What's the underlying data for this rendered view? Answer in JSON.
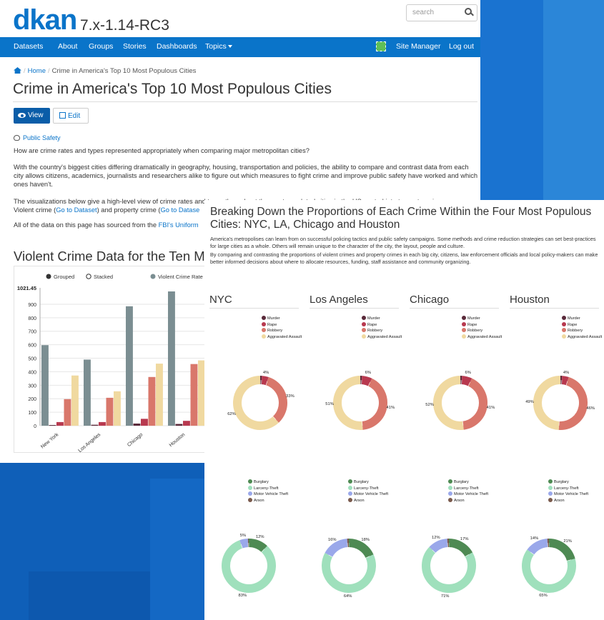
{
  "site": {
    "logo": "dkan",
    "version": "7.x-1.14-RC3",
    "search_placeholder": "search",
    "nav": [
      "Datasets",
      "About",
      "Groups",
      "Stories",
      "Dashboards",
      "Topics"
    ],
    "nav_right": [
      "Site Manager",
      "Log out"
    ]
  },
  "breadcrumb": {
    "home": "Home",
    "current": "Crime in America's Top 10 Most Populous Cities"
  },
  "page": {
    "title": "Crime in America's Top 10 Most Populous Cities",
    "view_label": "View",
    "edit_label": "Edit",
    "topic": "Public Safety",
    "p1": "How are crime rates and types represented appropriately when comparing major metropolitan cities?",
    "p2": "With the country's biggest cities differing dramatically in geography, housing, transportation and policies, the ability to compare and contrast data from each city allows citizens, academics, journalists and researchers alike to figure out which measures to fight crime and improve public safety have worked and which ones haven't.",
    "p3a": "The visualizations below give a high-level view of crime rates and types throughout the most populated cities in the US, sorted into two categories:",
    "p3b_pre": "Violent crime (",
    "p3b_link": "Go to Dataset",
    "p3b_mid": ") and property crime (",
    "p3b_link2": "Go to Datase",
    "p4_pre": "All of the data on this page has sourced from the ",
    "p4_link": "FBI's Uniform",
    "h2": "Violent Crime Data for the Ten Most"
  },
  "colors": {
    "brand": "#0a74c9",
    "murder": "#5a2a3a",
    "rape": "#b8394f",
    "robbery": "#d9776b",
    "assault": "#f0d9a0",
    "rate": "#7b8e92",
    "burglary": "#4e8a53",
    "larceny": "#9fe0bc",
    "vehicle": "#9aa8ea",
    "arson": "#7a5a4c"
  },
  "chart_data": [
    {
      "type": "bar",
      "controls": [
        "Grouped",
        "Stacked"
      ],
      "legend": [
        "Violent Crime Rate P..."
      ],
      "ymax_label": "1021.45",
      "yticks": [
        0,
        100,
        200,
        300,
        400,
        500,
        600,
        700,
        800,
        900
      ],
      "ylim": [
        0,
        1021.45
      ],
      "categories": [
        "New York",
        "Los Angeles",
        "Chicago",
        "Houston"
      ],
      "series": [
        {
          "name": "Violent Crime Rate P...",
          "values": [
            597,
            490,
            885,
            995
          ]
        },
        {
          "values": [
            5,
            7,
            16,
            13
          ]
        },
        {
          "values": [
            27,
            27,
            51,
            36
          ]
        },
        {
          "values": [
            197,
            207,
            361,
            457
          ]
        },
        {
          "values": [
            372,
            255,
            460,
            484
          ]
        }
      ]
    },
    {
      "type": "pie",
      "title": "Breaking Down the Proportions of Each Crime Within the Four Most Populous Cities: NYC, LA, Chicago and Houston",
      "p1": "America's metropolises can learn from on successful policing tactics and public safety campaigns. Some methods and crime reduction strategies can set best-practices for large cities as a whole. Others will remain unique to the character of the city, the layout, people and culture.",
      "p2": "By comparing and contrasting the proportions of violent crimes and property crimes in each big city, citizens, law enforcement officials and local policy-makers can make better informed decisions about where to allocate resources, funding, staff assistance and community organizing.",
      "cities": [
        "NYC",
        "Los Angeles",
        "Chicago",
        "Houston"
      ],
      "violent_labels": [
        "Murder",
        "Rape",
        "Robbery",
        "Aggravated Assault"
      ],
      "property_labels": [
        "Burglary",
        "Larceny-Theft",
        "Motor Vehicle Theft",
        "Arson"
      ],
      "violent": [
        {
          "values": [
            1,
            4,
            33,
            62
          ],
          "labels": [
            "",
            "4%",
            "33%",
            "62%"
          ]
        },
        {
          "values": [
            1,
            6,
            41,
            51
          ],
          "labels": [
            "",
            "6%",
            "41%",
            "51%"
          ]
        },
        {
          "values": [
            1,
            6,
            41,
            52
          ],
          "labels": [
            "",
            "6%",
            "41%",
            "52%"
          ]
        },
        {
          "values": [
            1,
            4,
            46,
            49
          ],
          "labels": [
            "",
            "4%",
            "46%",
            "49%"
          ]
        }
      ],
      "property": [
        {
          "values": [
            12,
            83,
            5,
            0.5
          ],
          "labels": [
            "12%",
            "83%",
            "5%",
            ""
          ]
        },
        {
          "values": [
            18,
            64,
            16,
            1
          ],
          "labels": [
            "18%",
            "64%",
            "16%",
            ""
          ]
        },
        {
          "values": [
            17,
            71,
            12,
            1
          ],
          "labels": [
            "17%",
            "71%",
            "12%",
            ""
          ]
        },
        {
          "values": [
            21,
            65,
            14,
            1
          ],
          "labels": [
            "21%",
            "65%",
            "14%",
            ""
          ]
        }
      ]
    }
  ]
}
